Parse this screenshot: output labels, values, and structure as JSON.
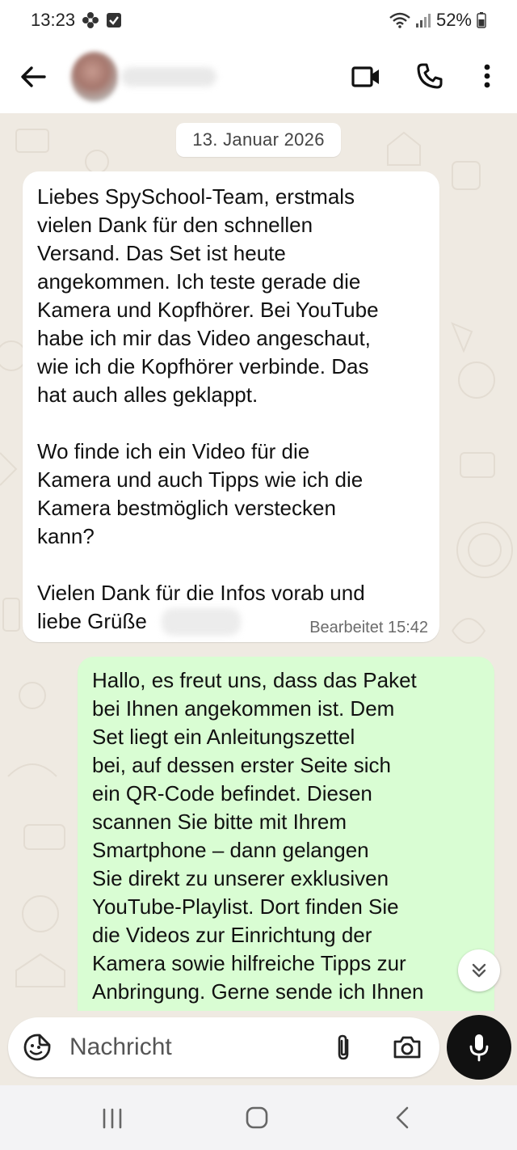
{
  "status_bar": {
    "time": "13:23",
    "battery": "52%",
    "icons": [
      "flower-notification-icon",
      "check-box-icon",
      "wifi-icon",
      "signal-icon",
      "battery-icon"
    ]
  },
  "header": {
    "icons": [
      "back-arrow-icon",
      "video-call-icon",
      "phone-icon",
      "more-vertical-icon"
    ]
  },
  "chat": {
    "date": "13. Januar 2026",
    "messages": [
      {
        "direction": "incoming",
        "text": "Liebes SpySchool-Team, erstmals\nvielen Dank für den schnellen\nVersand. Das Set ist heute\nangekommen. Ich teste gerade die\nKamera und Kopfhörer. Bei YouTube\nhabe ich mir das Video angeschaut,\nwie ich die Kopfhörer verbinde. Das\nhat auch alles geklappt.\n\nWo finde ich ein Video für die\nKamera und auch Tipps wie ich die\nKamera bestmöglich verstecken\nkann?\n\nVielen Dank für die Infos vorab und\nliebe Grüße",
        "meta": "Bearbeitet 15:42"
      },
      {
        "direction": "outgoing",
        "text": "Hallo, es freut uns, dass das Paket\nbei Ihnen angekommen ist. Dem\nSet liegt ein Anleitungszettel\nbei, auf dessen erster Seite sich\nein QR-Code befindet. Diesen\nscannen Sie bitte mit Ihrem\nSmartphone – dann gelangen\nSie direkt zu unserer exklusiven\nYouTube-Playlist. Dort finden Sie\ndie Videos zur Einrichtung der\nKamera sowie hilfreiche Tipps zur\nAnbringung. Gerne sende ich Ihnen"
      }
    ]
  },
  "composer": {
    "placeholder": "Nachricht",
    "icons": [
      "sticker-emoji-icon",
      "paperclip-icon",
      "camera-icon",
      "microphone-icon"
    ]
  },
  "nav_bar": {
    "icons": [
      "recents-icon",
      "home-icon",
      "back-chevron-icon"
    ]
  },
  "colors": {
    "chat_background": "#efeae2",
    "outgoing_bubble": "#d9fdd3",
    "incoming_bubble": "#ffffff",
    "mic_button": "#111111"
  }
}
